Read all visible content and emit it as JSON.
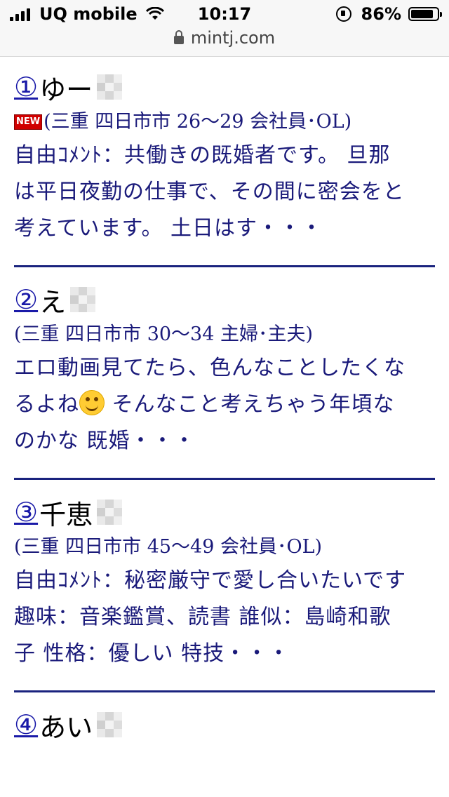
{
  "status_bar": {
    "carrier": "UQ mobile",
    "time": "10:17",
    "battery_percent": "86%",
    "battery_level": 0.86,
    "url": "mintj.com"
  },
  "entries": [
    {
      "number": "①",
      "name": "ゆー",
      "new_badge": "NEW",
      "meta": "(三重 四日市市 26〜29 会社員･OL)",
      "comment_lines": [
        "自由ｺﾒﾝﾄ：共働きの既婚者です。 旦那",
        "は平日夜勤の仕事で、その間に密会をと",
        "考えています。 土日はす・・・"
      ]
    },
    {
      "number": "②",
      "name": "え",
      "meta": "(三重 四日市市 30〜34 主婦･主夫)",
      "comment_line1": "エロ動画見てたら、色んなことしたくな",
      "comment_line2a": "るよね",
      "comment_line2b": " そんなこと考えちゃう年頃な",
      "comment_line3": "のかな 既婚・・・"
    },
    {
      "number": "③",
      "name": "千恵",
      "meta": "(三重 四日市市 45〜49 会社員･OL)",
      "comment_lines": [
        "自由ｺﾒﾝﾄ：秘密厳守で愛し合いたいです",
        "趣味：音楽鑑賞、読書 誰似：島崎和歌",
        "子 性格：優しい 特技・・・"
      ]
    },
    {
      "number": "④",
      "name": "あい"
    }
  ]
}
